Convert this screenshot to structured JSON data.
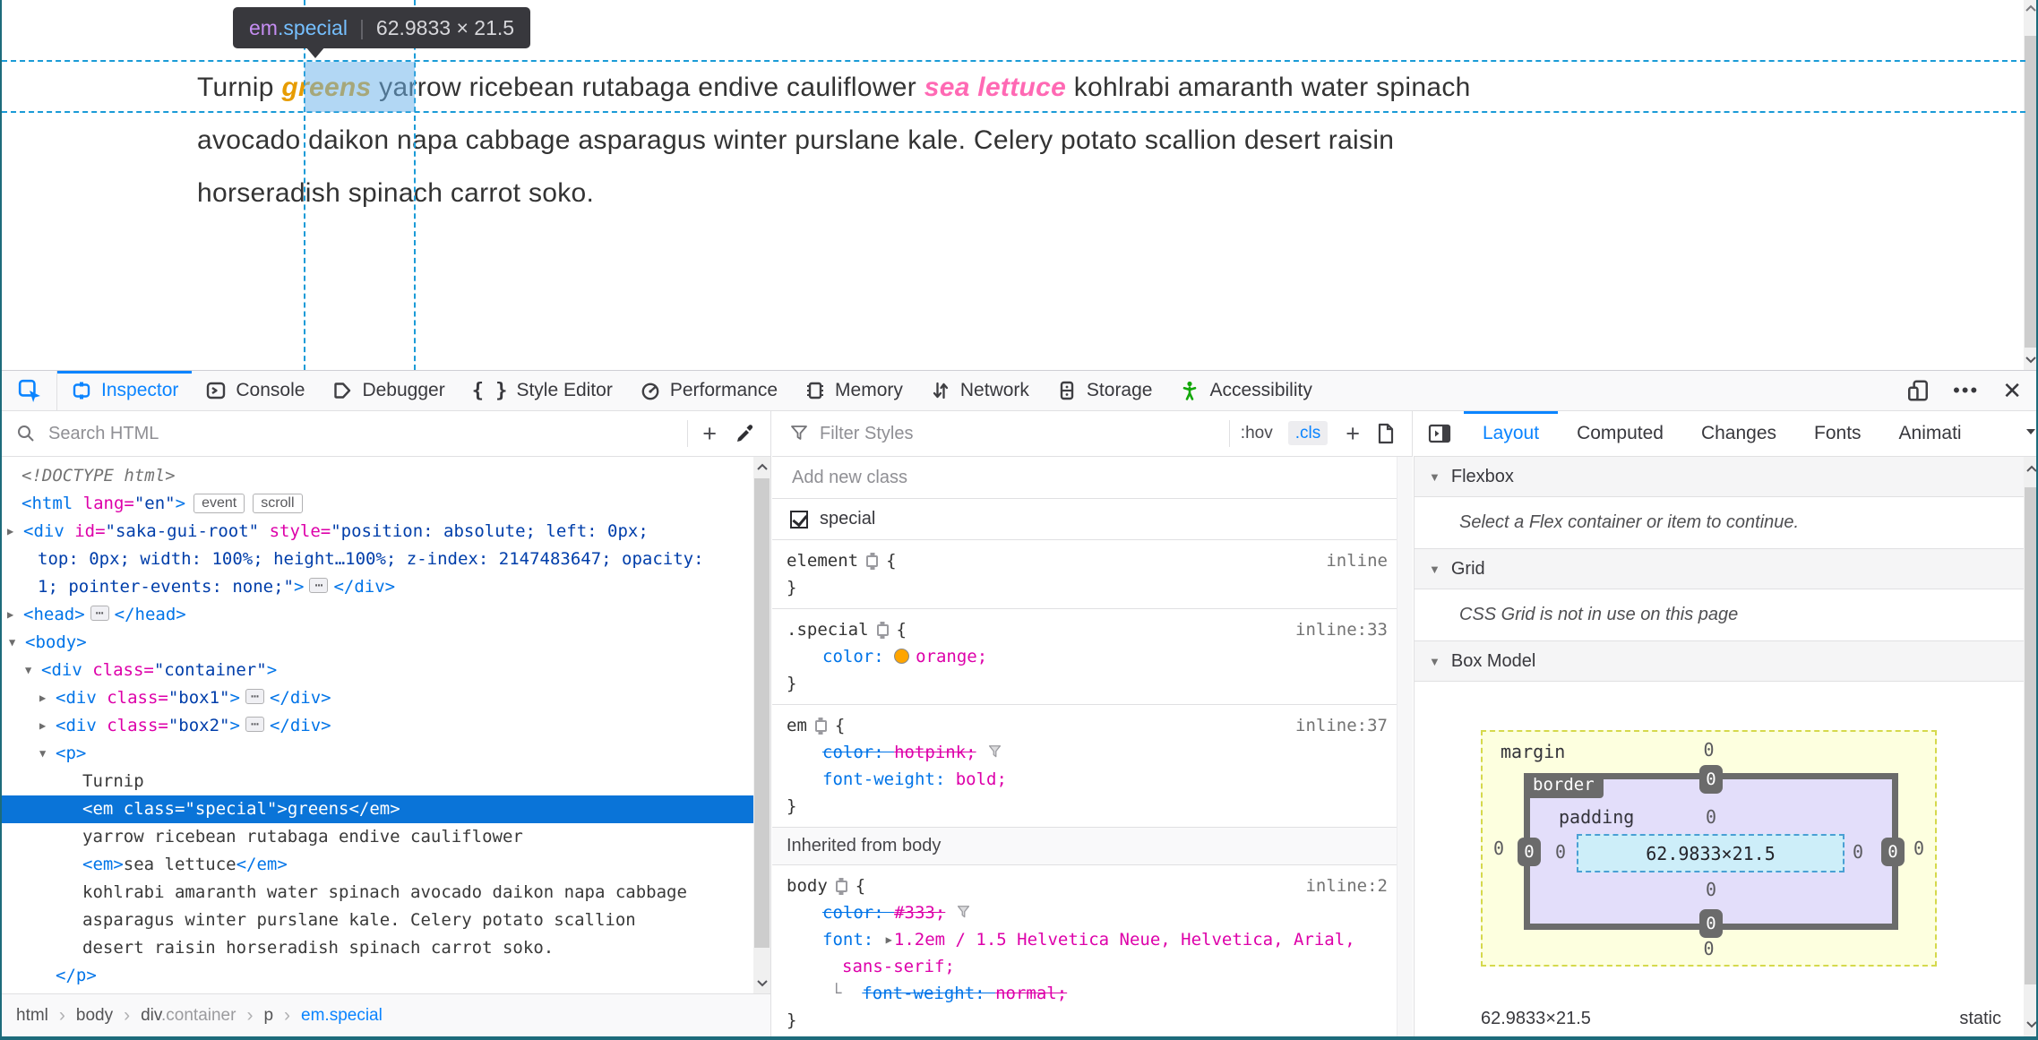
{
  "colors": {
    "accent": "#0a84ff",
    "selection_blue": "#0a74d8",
    "tag_blue": "#0074e8",
    "attr_magenta": "#dd00a9",
    "value_navy": "#003eaa",
    "hotpink": "#ff69b4",
    "orange_swatch": "#ffa500",
    "accessibility_green": "#12a708",
    "guide_blue": "#1a9bd7",
    "window_border": "#1d6b7b"
  },
  "page": {
    "tooltip": {
      "tag": "em",
      "cls": ".special",
      "sep": "|",
      "dims": "62.9833 × 21.5"
    },
    "line1": {
      "pre": "Turnip ",
      "em1": "greens",
      "mid": " yarrow ricebean rutabaga endive cauliflower ",
      "em2": "sea lettuce",
      "post": " kohlrabi amaranth water spinach"
    },
    "line2": "avocado daikon napa cabbage asparagus winter purslane kale. Celery potato scallion desert raisin",
    "line3": "horseradish spinach carrot soko."
  },
  "toolbar": {
    "tabs": {
      "inspector": "Inspector",
      "console": "Console",
      "debugger": "Debugger",
      "style_editor": "Style Editor",
      "performance": "Performance",
      "memory": "Memory",
      "network": "Network",
      "storage": "Storage",
      "accessibility": "Accessibility"
    },
    "style_editor_glyph": "{ }",
    "menu_dots": "•••",
    "close_glyph": "✕"
  },
  "markup": {
    "search_placeholder": "Search HTML",
    "plus": "+",
    "ellipsis": "⋯",
    "lines": {
      "doctype": "<!DOCTYPE html>",
      "html": {
        "open": "<html ",
        "attr": "lang=",
        "val": "\"en\"",
        "close": ">",
        "badge1": "event",
        "badge2": "scroll"
      },
      "saka1": {
        "open": "<div ",
        "attr1": "id=",
        "val1": "\"saka-gui-root\" ",
        "attr2": "style=",
        "val2": "\"position: absolute; left: 0px;"
      },
      "saka2": "top: 0px; width: 100%; height…100%; z-index: 2147483647; opacity:",
      "saka3": {
        "val": "1; pointer-events: none;\"",
        "close": ">",
        "end": "</div>"
      },
      "head": {
        "open": "<head>",
        "end": "</head>"
      },
      "body": "<body>",
      "container": {
        "open": "<div ",
        "attr": "class=",
        "val": "\"container\"",
        "close": ">"
      },
      "box1": {
        "open": "<div ",
        "attr": "class=",
        "val": "\"box1\"",
        "close": ">",
        "end": "</div>"
      },
      "box2": {
        "open": "<div ",
        "attr": "class=",
        "val": "\"box2\"",
        "close": ">",
        "end": "</div>"
      },
      "p_open": "<p>",
      "turnip": "Turnip",
      "em_special": {
        "open": "<em ",
        "attr": "class=",
        "val": "\"special\"",
        "close": ">",
        "text": "greens",
        "end": "</em>"
      },
      "yarrow": "yarrow ricebean rutabaga endive cauliflower",
      "em_sea": {
        "open": "<em>",
        "text": "sea lettuce",
        "end": "</em>"
      },
      "kohlrabi": "kohlrabi amaranth water spinach avocado daikon napa cabbage",
      "asparagus": "asparagus winter purslane kale. Celery potato scallion",
      "desert": "desert raisin horseradish spinach carrot soko.",
      "p_close": "</p>"
    },
    "breadcrumb": {
      "i1": "html",
      "i2": "body",
      "i3_tag": "div",
      "i3_cls": ".container",
      "i4": "p",
      "i5": "em.special",
      "sep": "›"
    }
  },
  "rules": {
    "filter_placeholder": "Filter Styles",
    "hov": ":hov",
    "cls": ".cls",
    "plus": "+",
    "add_class_placeholder": "Add new class",
    "class_toggle": {
      "label": "special"
    },
    "element_rule": {
      "selector": "element",
      "open": "{",
      "close": "}",
      "location": "inline"
    },
    "special_rule": {
      "selector": ".special",
      "open": "{",
      "close": "}",
      "location": "inline:33",
      "prop": "color: ",
      "value": "orange;"
    },
    "em_rule": {
      "selector": "em",
      "open": "{",
      "close": "}",
      "location": "inline:37",
      "decl1_prop": "color: ",
      "decl1_value": "hotpink;",
      "decl2_prop": "font-weight: ",
      "decl2_value": "bold;"
    },
    "inherited_header": "Inherited from body",
    "body_rule": {
      "selector": "body",
      "open": "{",
      "close": "}",
      "location": "inline:2",
      "decl1_prop": "color: ",
      "decl1_value": "#333;",
      "decl2_prop": "font: ",
      "decl2_value": "1.2em / 1.5 Helvetica Neue, Helvetica, Arial,",
      "decl2_wrap": "sans-serif;",
      "sub_connector": "└",
      "decl3_prop": "font-weight: ",
      "decl3_value": "normal;"
    }
  },
  "layout": {
    "tabs": {
      "layout": "Layout",
      "computed": "Computed",
      "changes": "Changes",
      "fonts": "Fonts",
      "animations": "Animati"
    },
    "flexbox": {
      "title": "Flexbox",
      "message": "Select a Flex container or item to continue."
    },
    "grid": {
      "title": "Grid",
      "message": "CSS Grid is not in use on this page"
    },
    "boxmodel": {
      "title": "Box Model",
      "margin_label": "margin",
      "border_label": "border",
      "padding_label": "padding",
      "content": "62.9833×21.5",
      "margin": {
        "top": "0",
        "right": "0",
        "bottom": "0",
        "left": "0"
      },
      "border": {
        "top": "0",
        "right": "0",
        "bottom": "0",
        "left": "0"
      },
      "padding": {
        "top": "0",
        "right": "0",
        "bottom": "0",
        "left": "0"
      },
      "footer_size": "62.9833×21.5",
      "footer_position": "static"
    }
  }
}
